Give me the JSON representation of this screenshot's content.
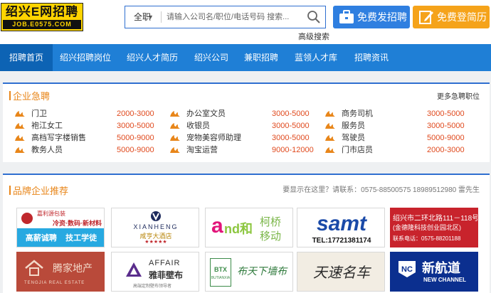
{
  "header": {
    "logo_cn": "绍兴E网招聘",
    "logo_url": "JOB.E0575.COM",
    "search_scope": "全职",
    "search_placeholder": "请输入公司名/职位/电话号码 搜索...",
    "advanced_search": "高级搜索",
    "post_job_label": "免费发招聘",
    "post_resume_label": "免费登简历"
  },
  "nav": [
    "招聘首页",
    "绍兴招聘岗位",
    "绍兴人才简历",
    "绍兴公司",
    "兼职招聘",
    "蓝领人才库",
    "招聘资讯"
  ],
  "urgent": {
    "title": "企业急聘",
    "more": "更多急聘职位",
    "columns": [
      [
        {
          "title": "门卫",
          "salary": "2000-3000"
        },
        {
          "title": "袍江女工",
          "salary": "3000-5000"
        },
        {
          "title": "高档写字楼销售",
          "salary": "5000-9000"
        },
        {
          "title": "教务人员",
          "salary": "5000-9000"
        }
      ],
      [
        {
          "title": "办公室文员",
          "salary": "3000-5000"
        },
        {
          "title": "收银员",
          "salary": "3000-5000"
        },
        {
          "title": "宠物美容师助理",
          "salary": "3000-5000"
        },
        {
          "title": "淘宝运营",
          "salary": "9000-12000"
        }
      ],
      [
        {
          "title": "商务司机",
          "salary": "3000-5000"
        },
        {
          "title": "服务员",
          "salary": "3000-5000"
        },
        {
          "title": "驾驶员",
          "salary": "5000-9000"
        },
        {
          "title": "门市店员",
          "salary": "2000-3000"
        }
      ]
    ]
  },
  "brand": {
    "title": "品牌企业推荐",
    "contact": "要显示在这里？请联系：0575-88500575    18989512980    雷先生",
    "logos": {
      "t1_name": "嘉利源包装",
      "t1_line1": "冷资·数码·新材料",
      "t1_line2": "高薪诚聘    技工学徒",
      "t2_name": "XIANHENG",
      "t2_sub": "咸亨大酒店",
      "t3_a": "a",
      "t3_b": "nd和",
      "t3_cn1": "柯桥",
      "t3_cn2": "移动",
      "t4_name": "samt",
      "t4_tel": "TEL:17721381174",
      "t5_line1": "绍兴市二环北路111－118号",
      "t5_line2": "(金德隆科技创业园北区)",
      "t5_line3": "联系电话：0575-88201188",
      "t6_name": "腾家地产",
      "t6_sub": "TENGJIA REAL ESTATE",
      "t7_name": "AFFAIR",
      "t7_cn": "雅菲壁布",
      "t7_sub": "高端定制壁布领导者",
      "t8_badge": "BTX",
      "t8_en": "BUTIANXIA",
      "t8_cn": "布天下墙布",
      "t9_cn": "天速名车",
      "t10_cn": "新航道",
      "t10_en": "NEW CHANNEL"
    }
  },
  "colors": {
    "nav_blue": "#1f7fd6",
    "nav_active": "#0d63b4",
    "accent_orange": "#e8861a",
    "salary_red": "#e04a1e",
    "post_btn": "#2f7fe0",
    "resume_btn": "#f5a31a"
  }
}
